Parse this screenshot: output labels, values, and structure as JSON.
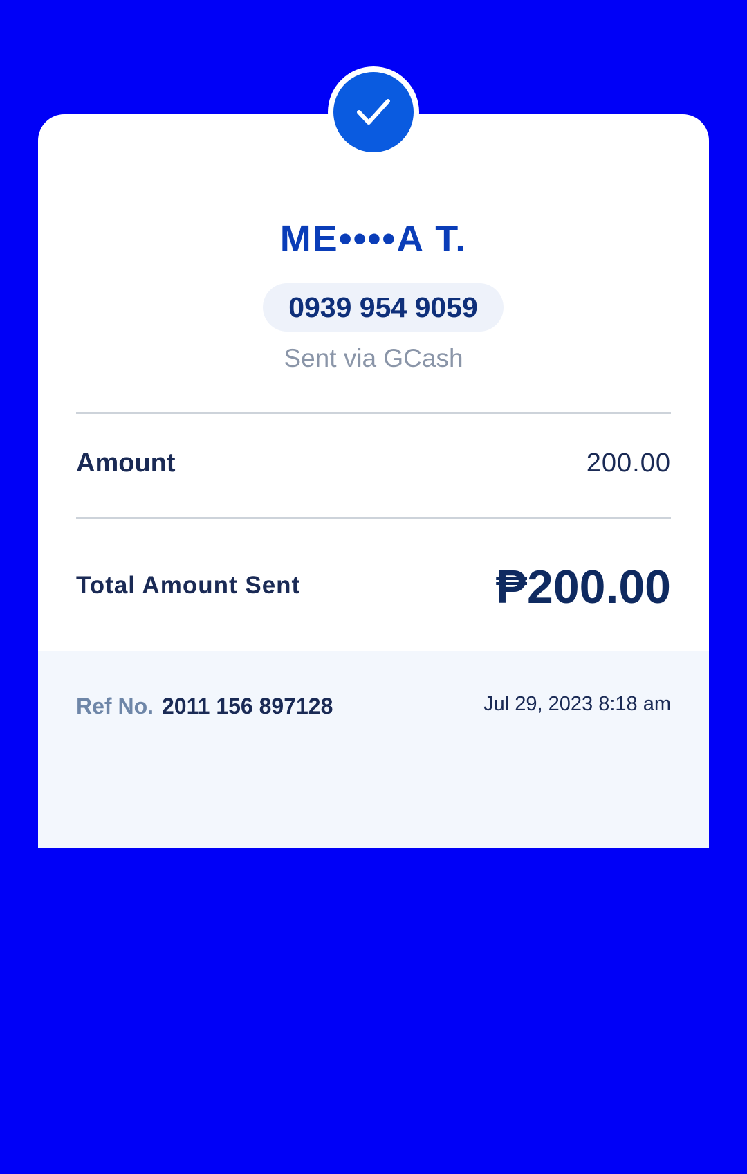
{
  "recipient": {
    "name": "ME••••A T.",
    "phone": "0939 954 9059",
    "sent_via": "Sent via GCash"
  },
  "details": {
    "amount_label": "Amount",
    "amount_value": "200.00",
    "total_label": "Total Amount Sent",
    "total_value": "₱200.00"
  },
  "reference": {
    "ref_label": "Ref No.",
    "ref_number": "2011 156 897128",
    "datetime": "Jul 29, 2023 8:18 am"
  },
  "icons": {
    "status": "check-icon"
  },
  "colors": {
    "background": "#0000F7",
    "accent": "#0A5BE0",
    "name_text": "#0A3DB8",
    "primary_text": "#1A2A55",
    "muted_text": "#8A95A8"
  }
}
